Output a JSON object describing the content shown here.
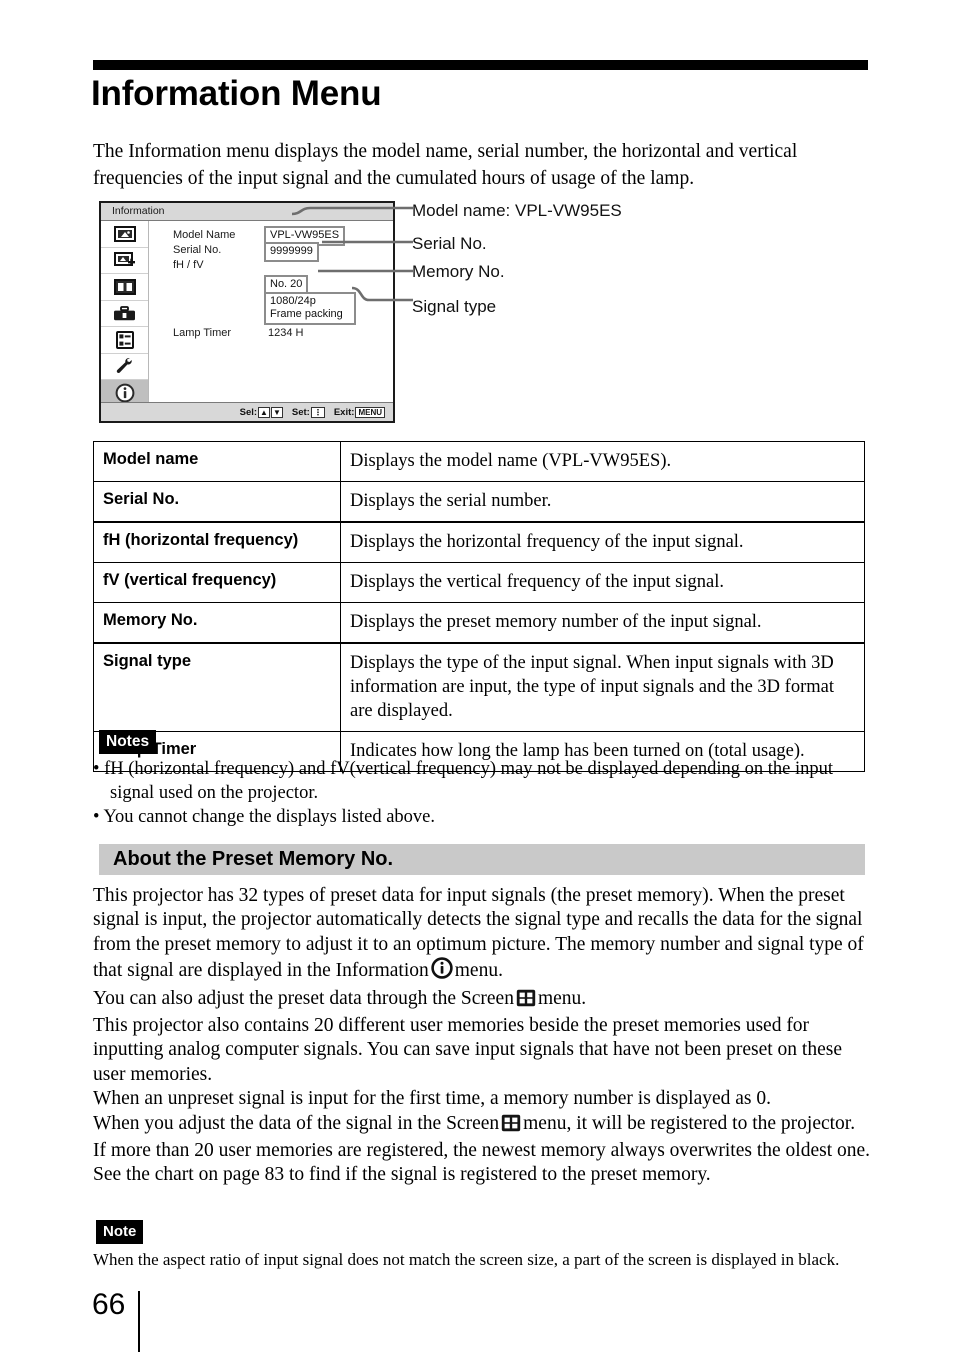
{
  "document": {
    "title": "Information Menu",
    "page_number": "66",
    "intro": "The Information menu displays the model name, serial number, the horizontal and vertical frequencies of the input signal and the cumulated hours of usage of the lamp."
  },
  "osd": {
    "header": "Information",
    "rail_icons": [
      "picture-icon",
      "picture-adjust-icon",
      "screen-icon",
      "toolbox-icon",
      "function-list-icon",
      "wrench-icon",
      "information-icon"
    ],
    "rows": {
      "model_name_label": "Model Name",
      "model_name_value": "VPL-VW95ES",
      "serial_no_label": "Serial No.",
      "serial_no_value": "9999999",
      "fh_fv_label": "fH / fV",
      "memory_no_value": "No. 20",
      "signal_type_value_line1": "1080/24p",
      "signal_type_value_line2": "Frame packing",
      "lamp_timer_label": "Lamp Timer",
      "lamp_timer_value": "1234 H"
    },
    "footer": {
      "sel": "Sel:",
      "set": "Set:",
      "exit": "Exit:",
      "exit_key": "MENU"
    }
  },
  "callouts": [
    {
      "text": "Model name: VPL-VW95ES"
    },
    {
      "text": "Serial No."
    },
    {
      "text": "Memory No."
    },
    {
      "text": "Signal type"
    }
  ],
  "spec_table": {
    "rows": [
      {
        "key": "Model name",
        "value": "Displays the model name (VPL-VW95ES)."
      },
      {
        "key": "Serial No.",
        "value": "Displays the serial number."
      },
      {
        "key": "fH (horizontal frequency)",
        "value": "Displays the horizontal frequency of the input signal."
      },
      {
        "key": "fV (vertical frequency)",
        "value": "Displays the vertical frequency of the input signal."
      },
      {
        "key": "Memory No.",
        "value": "Displays the preset memory number of the input signal."
      },
      {
        "key": "Signal type",
        "value": "Displays the type of the input signal. When input signals with 3D information are input, the type of input signals and the 3D format are displayed."
      },
      {
        "key": "Lamp Timer",
        "value": "Indicates how long the lamp has been turned on (total usage)."
      }
    ]
  },
  "notes_block": {
    "tag": "Notes",
    "items": [
      "fH (horizontal frequency) and fV(vertical frequency) may not be displayed depending on the input signal used on the projector.",
      "You cannot change the displays listed above."
    ],
    "bullet": "•"
  },
  "section": {
    "heading": "About the Preset Memory No.",
    "para1_a": "This projector has 32 types of preset data for input signals (the preset memory). When the preset signal is input, the projector automatically detects the signal type and recalls the data for the signal from the preset memory to adjust it to an optimum picture. The memory number and signal type of that signal are displayed in the Information",
    "para1_b": "menu.",
    "para2_a": "You can also adjust the preset data through the Screen",
    "para2_b": "menu.",
    "para3": "This projector also contains 20 different user memories beside the preset memories used for inputting analog computer signals. You can save input signals that have not been preset on these user memories.",
    "para4": "When an unpreset signal is input for the first time, a memory number is displayed as 0.",
    "para5_a": "When you adjust the data of the signal in the Screen",
    "para5_b": "menu, it will be registered to the projector. If more than 20 user memories are registered, the newest memory always overwrites the oldest one.",
    "para6": "See the chart on page 83 to find if the signal is registered to the preset memory."
  },
  "final_note": {
    "tag": "Note",
    "text": "When the aspect ratio of input signal does not match the screen size, a part of the screen is displayed in black."
  },
  "colors": {
    "osd_header_bg": "#d8d8d8",
    "osd_selected_bg": "#bfbfbf",
    "section_band_bg": "#c9c9c9",
    "tag_bg": "#000000",
    "text": "#000000"
  }
}
